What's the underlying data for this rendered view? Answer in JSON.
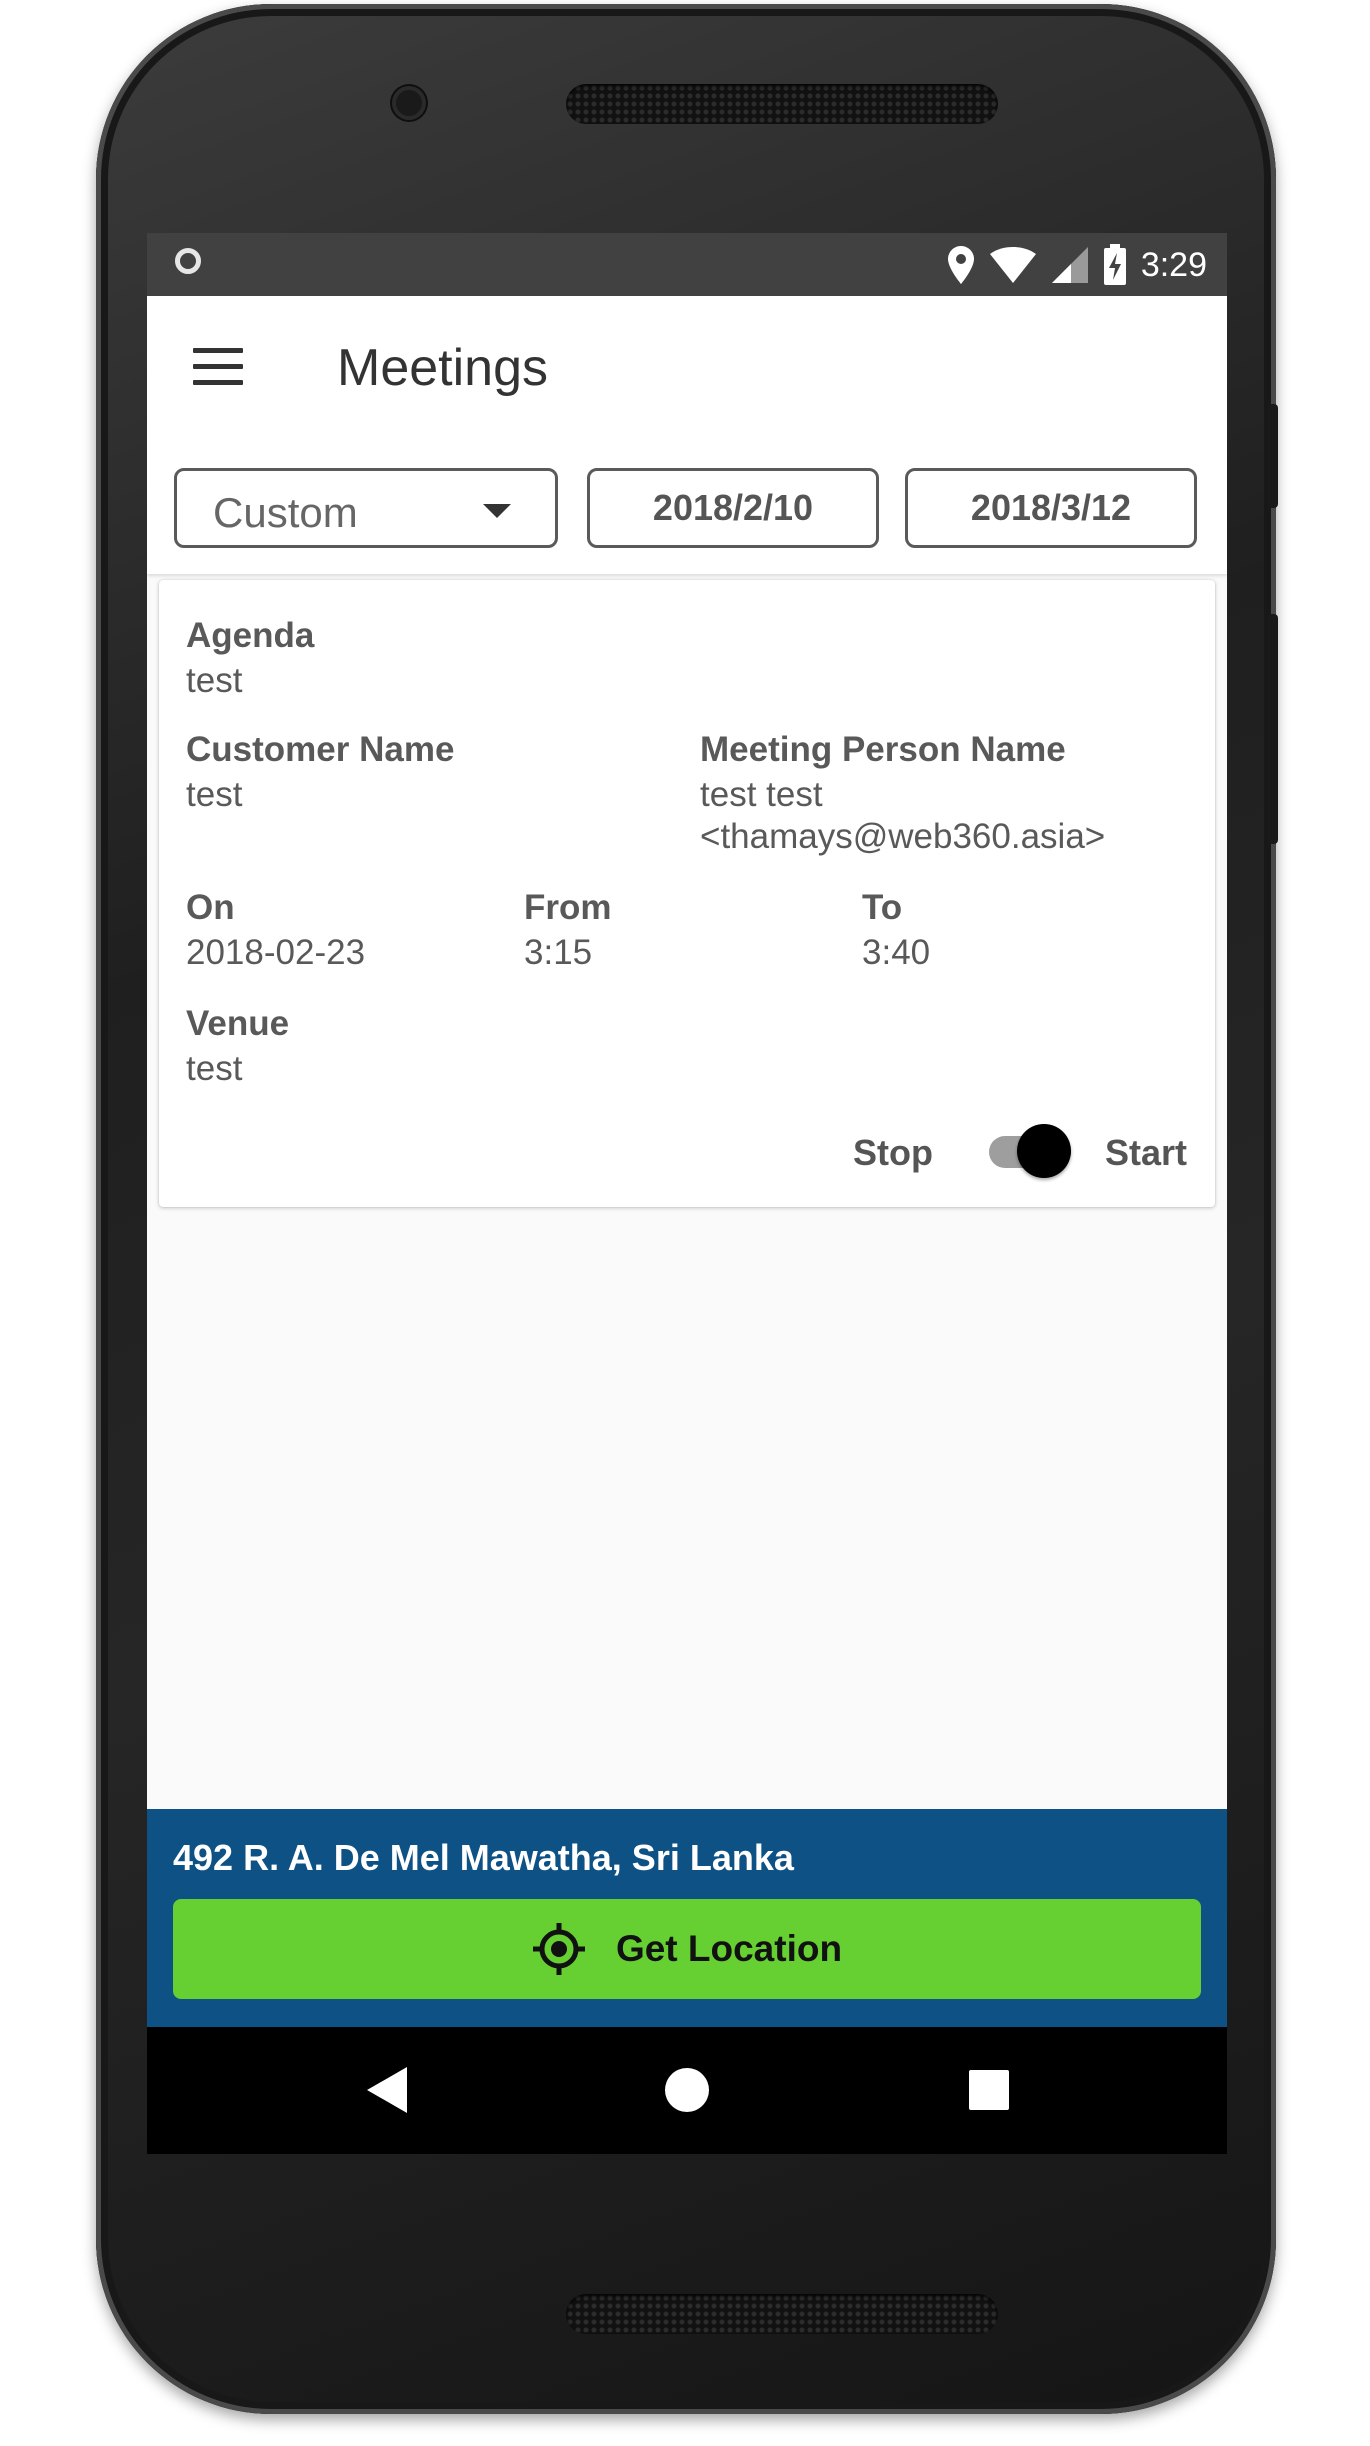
{
  "status_bar": {
    "time": "3:29",
    "icons": [
      "notification-circle-icon",
      "location-pin-icon",
      "wifi-icon",
      "signal-icon",
      "battery-charging-icon"
    ]
  },
  "app_bar": {
    "title": "Meetings",
    "menu_icon": "hamburger-menu-icon"
  },
  "filters": {
    "period_select": {
      "selected": "Custom"
    },
    "from_date": "2018/2/10",
    "to_date": "2018/3/12"
  },
  "meeting": {
    "agenda_label": "Agenda",
    "agenda": "test",
    "customer_label": "Customer Name",
    "customer": "test",
    "person_label": "Meeting Person Name",
    "person_name": "test test",
    "person_email": "<thamays@web360.asia>",
    "on_label": "On",
    "on": "2018-02-23",
    "from_label": "From",
    "from": "3:15",
    "to_label": "To",
    "to": "3:40",
    "venue_label": "Venue",
    "venue": "test",
    "stop_label": "Stop",
    "start_label": "Start",
    "switch_on": true
  },
  "location": {
    "address": "492 R. A. De Mel Mawatha, Sri Lanka",
    "button_label": "Get Location",
    "button_icon": "gps-target-icon",
    "panel_color": "#0d5185",
    "button_color": "#66cf31"
  },
  "nav_bar": {
    "icons": [
      "back-triangle-icon",
      "home-circle-icon",
      "recents-square-icon"
    ]
  }
}
